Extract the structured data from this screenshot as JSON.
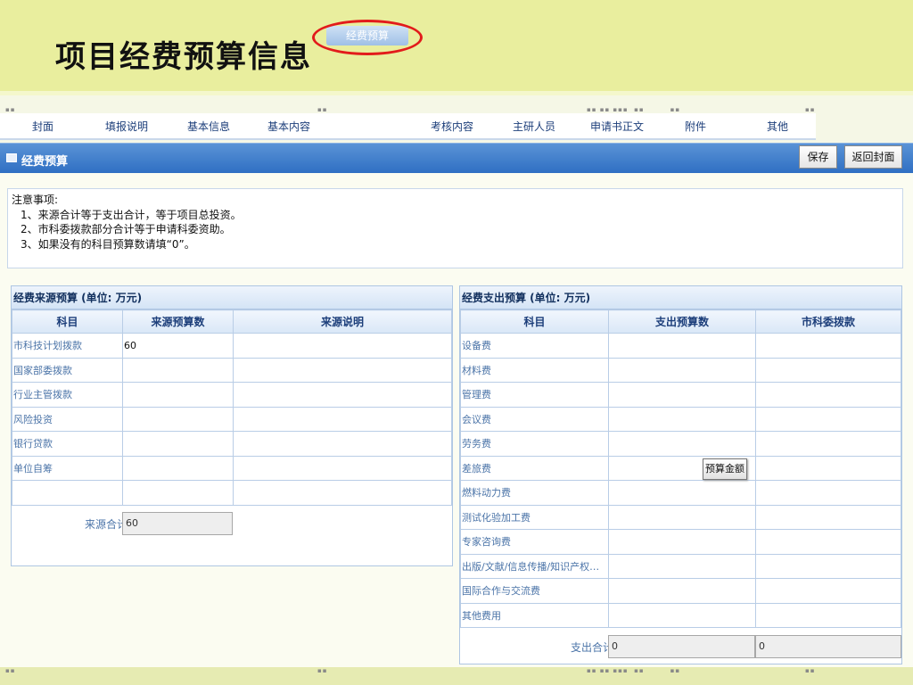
{
  "slide_title": "项目经费预算信息",
  "tabs": [
    "封面",
    "填报说明",
    "基本信息",
    "基本内容",
    "经费预算",
    "考核内容",
    "主研人员",
    "申请书正文",
    "附件",
    "其他"
  ],
  "panel": {
    "title": "经费预算",
    "save_label": "保存",
    "back_label": "返回封面"
  },
  "notes": {
    "heading": "注意事项:",
    "items": [
      "1、来源合计等于支出合计，等于项目总投资。",
      "2、市科委拨款部分合计等于申请科委资助。",
      "3、如果没有的科目预算数请填“0”。"
    ]
  },
  "source_budget": {
    "title": "经费来源预算 (单位: 万元)",
    "columns": [
      "科目",
      "来源预算数",
      "来源说明"
    ],
    "rows": [
      {
        "subject": "市科技计划拨款",
        "amount": "60",
        "note": ""
      },
      {
        "subject": "国家部委拨款",
        "amount": "",
        "note": ""
      },
      {
        "subject": "行业主管拨款",
        "amount": "",
        "note": ""
      },
      {
        "subject": "风险投资",
        "amount": "",
        "note": ""
      },
      {
        "subject": "银行贷款",
        "amount": "",
        "note": ""
      },
      {
        "subject": "单位自筹",
        "amount": "",
        "note": ""
      },
      {
        "subject": "",
        "amount": "",
        "note": ""
      }
    ],
    "total_label": "来源合计",
    "total_value": "60"
  },
  "expense_budget": {
    "title": "经费支出预算 (单位: 万元)",
    "columns": [
      "科目",
      "支出预算数",
      "市科委拨款"
    ],
    "rows": [
      "设备费",
      "材料费",
      "管理费",
      "会议费",
      "劳务费",
      "差旅费",
      "燃料动力费",
      "测试化验加工费",
      "专家咨询费",
      "出版/文献/信息传播/知识产权事...",
      "国际合作与交流费",
      "其他费用"
    ],
    "total_label": "支出合计",
    "total_value": "0",
    "total_grant": "0"
  },
  "tooltip": "预算金额",
  "colors": {
    "slide_bg": "#e9ee9e",
    "header_blue": "#2f6fc3",
    "highlight_ring": "#e21b1b"
  }
}
